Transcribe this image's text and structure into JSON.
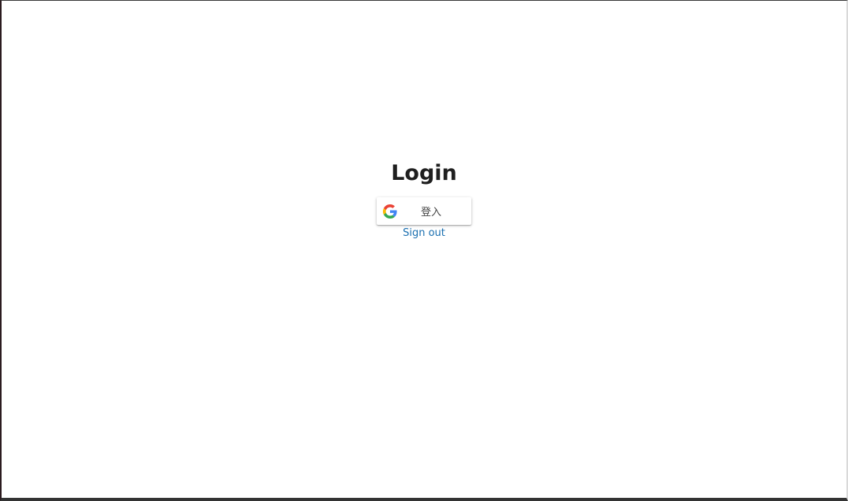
{
  "login": {
    "title": "Login",
    "google_button": {
      "icon": "google-g-icon",
      "label": "登入"
    },
    "sign_out_label": "Sign out"
  },
  "colors": {
    "background": "#ffffff",
    "title": "#1f1f1f",
    "link": "#1a6fb0",
    "button_text": "#444444"
  }
}
